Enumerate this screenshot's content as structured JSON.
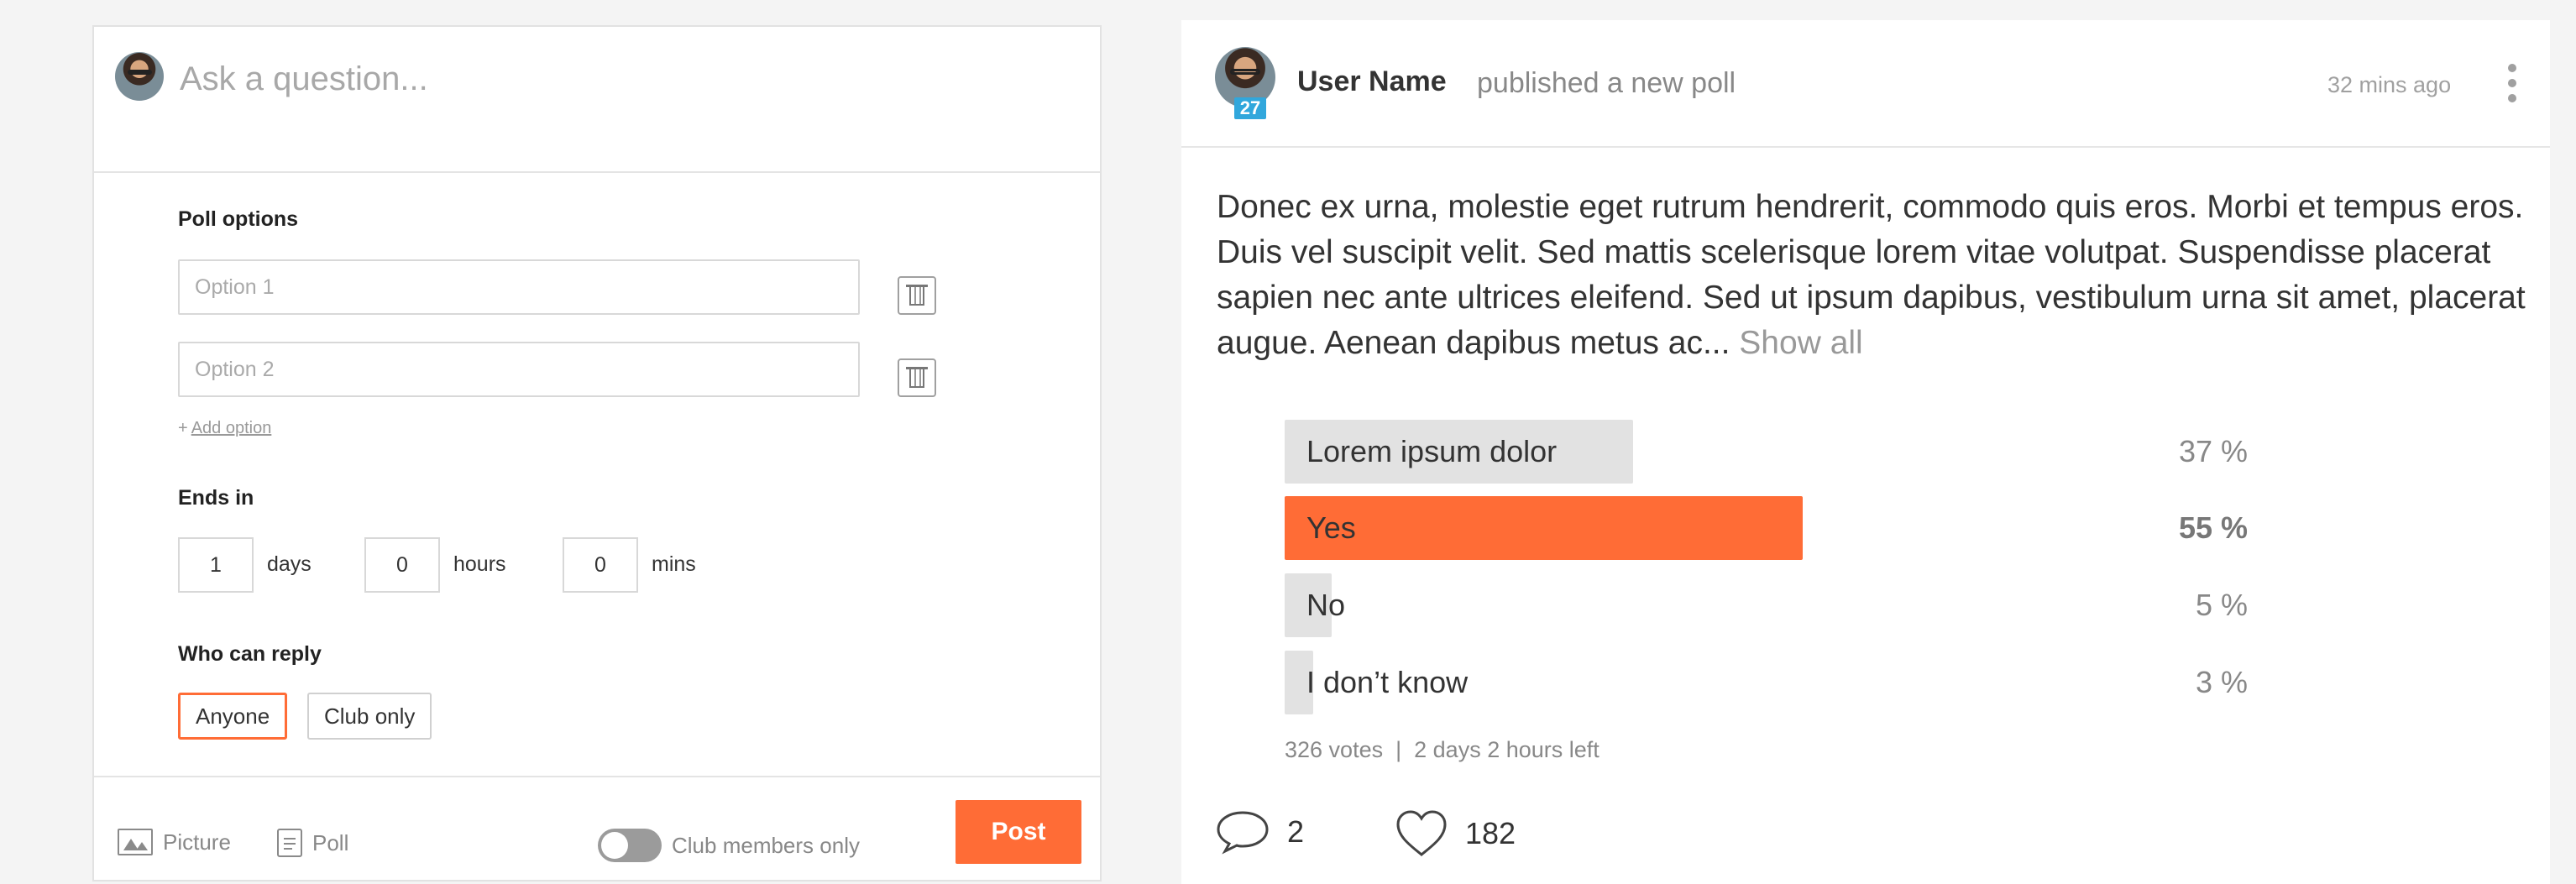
{
  "composer": {
    "question_placeholder": "Ask a question...",
    "poll_options_label": "Poll options",
    "options": [
      {
        "placeholder": "Option 1"
      },
      {
        "placeholder": "Option 2"
      }
    ],
    "add_option_prefix": "+",
    "add_option_label": "Add option",
    "ends_in_label": "Ends in",
    "ends_in": {
      "days_value": "1",
      "days_label": "days",
      "hours_value": "0",
      "hours_label": "hours",
      "mins_value": "0",
      "mins_label": "mins"
    },
    "who_can_reply_label": "Who can reply",
    "reply_options": [
      "Anyone",
      "Club only"
    ],
    "reply_selected": "Anyone",
    "footer": {
      "picture_label": "Picture",
      "poll_label": "Poll",
      "club_members_only_label": "Club members only",
      "club_members_only_on": false,
      "post_label": "Post"
    }
  },
  "feed_post": {
    "user_name": "User Name",
    "action": "published a new poll",
    "badge": "27",
    "time": "32 mins ago",
    "body": "Donec ex urna, molestie eget rutrum hendrerit, commodo quis eros. Morbi et tempus eros. Duis vel suscipit velit. Sed mattis scelerisque lorem vitae volutpat. Suspendisse placerat sapien nec ante ultrices eleifend. Sed ut ipsum dapibus, vestibulum urna sit amet, placerat augue. Aenean dapibus metus ac...",
    "show_all": "Show all",
    "poll": [
      {
        "label": "Lorem ipsum dolor",
        "percent": 37,
        "percent_text": "37 %",
        "winner": false
      },
      {
        "label": "Yes",
        "percent": 55,
        "percent_text": "55 %",
        "winner": true
      },
      {
        "label": "No",
        "percent": 5,
        "percent_text": "5 %",
        "winner": false
      },
      {
        "label": "I don’t know",
        "percent": 3,
        "percent_text": "3 %",
        "winner": false
      }
    ],
    "votes": "326 votes",
    "meta_separator": "|",
    "time_left": "2 days 2 hours left",
    "comments_count": "2",
    "likes_count": "182"
  },
  "colors": {
    "accent": "#ff6c36",
    "badge": "#31a7dc",
    "bar_default": "#e2e2e2"
  }
}
